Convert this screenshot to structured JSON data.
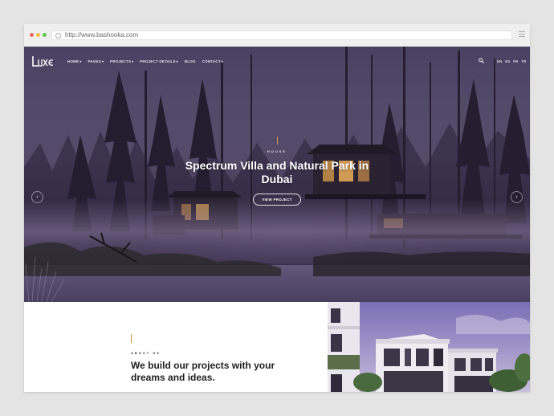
{
  "browser": {
    "url": "http://www.bashooka.com"
  },
  "site": {
    "logo_text": "LUXE",
    "nav": [
      {
        "label": "HOME",
        "has_menu": true
      },
      {
        "label": "PAGES",
        "has_menu": true
      },
      {
        "label": "PROJECTS",
        "has_menu": true
      },
      {
        "label": "PROJECT DETAILS",
        "has_menu": true
      },
      {
        "label": "BLOG",
        "has_menu": false
      },
      {
        "label": "CONTACT",
        "has_menu": true
      }
    ],
    "caret": "▾",
    "languages": [
      "EN",
      "ES",
      "FR",
      "TR"
    ]
  },
  "hero": {
    "eyebrow": "HOUSE",
    "title": "Spectrum Villa and Natural Park in Dubai",
    "button_label": "VIEW PROJECT",
    "prev_arrow": "‹",
    "next_arrow": "›"
  },
  "about": {
    "eyebrow": "ABOUT US",
    "title": "We build our projects with your dreams and ideas."
  },
  "colors": {
    "accent": "#d8913a",
    "hero_dark": "#2e2434",
    "hero_mist": "#7a6a8a"
  },
  "icons": [
    "search-icon",
    "lock-icon",
    "menu-icon",
    "chevron-left-icon",
    "chevron-right-icon"
  ]
}
